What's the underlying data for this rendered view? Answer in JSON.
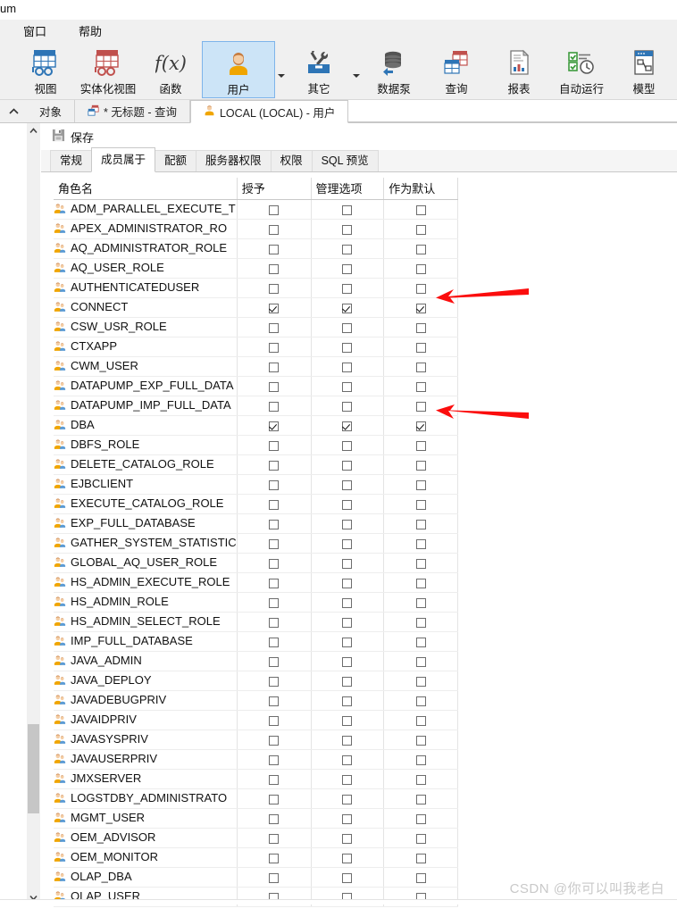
{
  "window": {
    "stray_title_fragment": "um"
  },
  "menubar": {
    "items": [
      {
        "label": "窗口",
        "name": "menu-window"
      },
      {
        "label": "帮助",
        "name": "menu-help"
      }
    ]
  },
  "ribbon": {
    "items": [
      {
        "label": "视图",
        "icon": "view-table-icon",
        "selected": false,
        "dropdown": false
      },
      {
        "label": "实体化视图",
        "icon": "materialized-view-icon",
        "selected": false,
        "dropdown": false
      },
      {
        "label": "函数",
        "icon": "function-fx-icon",
        "selected": false,
        "dropdown": false
      },
      {
        "label": "用户",
        "icon": "user-icon",
        "selected": true,
        "dropdown": true
      },
      {
        "label": "其它",
        "icon": "tools-icon",
        "selected": false,
        "dropdown": true
      },
      {
        "label": "数据泵",
        "icon": "datapump-icon",
        "selected": false,
        "dropdown": false
      },
      {
        "label": "查询",
        "icon": "query-icon",
        "selected": false,
        "dropdown": false
      },
      {
        "label": "报表",
        "icon": "report-icon",
        "selected": false,
        "dropdown": false
      },
      {
        "label": "自动运行",
        "icon": "automation-icon",
        "selected": false,
        "dropdown": false
      },
      {
        "label": "模型",
        "icon": "model-icon",
        "selected": false,
        "dropdown": false
      }
    ]
  },
  "tabstrip": {
    "collapse_icon": "chevron-up-icon",
    "tabs": [
      {
        "label": "对象",
        "icon": "",
        "active": false
      },
      {
        "label": "* 无标题 - 查询",
        "icon": "query-icon",
        "active": false
      },
      {
        "label": "LOCAL (LOCAL) - 用户",
        "icon": "user-icon",
        "active": true
      }
    ]
  },
  "toolbar": {
    "save_label": "保存",
    "save_icon": "save-icon"
  },
  "subtabs": [
    {
      "label": "常规",
      "active": false
    },
    {
      "label": "成员属于",
      "active": true
    },
    {
      "label": "配额",
      "active": false
    },
    {
      "label": "服务器权限",
      "active": false
    },
    {
      "label": "权限",
      "active": false
    },
    {
      "label": "SQL 预览",
      "active": false
    }
  ],
  "grid": {
    "columns": [
      "角色名",
      "授予",
      "管理选项",
      "作为默认"
    ],
    "rows": [
      {
        "name": "ADM_PARALLEL_EXECUTE_T",
        "granted": false,
        "admin": false,
        "default": false
      },
      {
        "name": "APEX_ADMINISTRATOR_RO",
        "granted": false,
        "admin": false,
        "default": false
      },
      {
        "name": "AQ_ADMINISTRATOR_ROLE",
        "granted": false,
        "admin": false,
        "default": false
      },
      {
        "name": "AQ_USER_ROLE",
        "granted": false,
        "admin": false,
        "default": false
      },
      {
        "name": "AUTHENTICATEDUSER",
        "granted": false,
        "admin": false,
        "default": false
      },
      {
        "name": "CONNECT",
        "granted": true,
        "admin": true,
        "default": true
      },
      {
        "name": "CSW_USR_ROLE",
        "granted": false,
        "admin": false,
        "default": false
      },
      {
        "name": "CTXAPP",
        "granted": false,
        "admin": false,
        "default": false
      },
      {
        "name": "CWM_USER",
        "granted": false,
        "admin": false,
        "default": false
      },
      {
        "name": "DATAPUMP_EXP_FULL_DATA",
        "granted": false,
        "admin": false,
        "default": false
      },
      {
        "name": "DATAPUMP_IMP_FULL_DATA",
        "granted": false,
        "admin": false,
        "default": false
      },
      {
        "name": "DBA",
        "granted": true,
        "admin": true,
        "default": true
      },
      {
        "name": "DBFS_ROLE",
        "granted": false,
        "admin": false,
        "default": false
      },
      {
        "name": "DELETE_CATALOG_ROLE",
        "granted": false,
        "admin": false,
        "default": false
      },
      {
        "name": "EJBCLIENT",
        "granted": false,
        "admin": false,
        "default": false
      },
      {
        "name": "EXECUTE_CATALOG_ROLE",
        "granted": false,
        "admin": false,
        "default": false
      },
      {
        "name": "EXP_FULL_DATABASE",
        "granted": false,
        "admin": false,
        "default": false
      },
      {
        "name": "GATHER_SYSTEM_STATISTIC",
        "granted": false,
        "admin": false,
        "default": false
      },
      {
        "name": "GLOBAL_AQ_USER_ROLE",
        "granted": false,
        "admin": false,
        "default": false
      },
      {
        "name": "HS_ADMIN_EXECUTE_ROLE",
        "granted": false,
        "admin": false,
        "default": false
      },
      {
        "name": "HS_ADMIN_ROLE",
        "granted": false,
        "admin": false,
        "default": false
      },
      {
        "name": "HS_ADMIN_SELECT_ROLE",
        "granted": false,
        "admin": false,
        "default": false
      },
      {
        "name": "IMP_FULL_DATABASE",
        "granted": false,
        "admin": false,
        "default": false
      },
      {
        "name": "JAVA_ADMIN",
        "granted": false,
        "admin": false,
        "default": false
      },
      {
        "name": "JAVA_DEPLOY",
        "granted": false,
        "admin": false,
        "default": false
      },
      {
        "name": "JAVADEBUGPRIV",
        "granted": false,
        "admin": false,
        "default": false
      },
      {
        "name": "JAVAIDPRIV",
        "granted": false,
        "admin": false,
        "default": false
      },
      {
        "name": "JAVASYSPRIV",
        "granted": false,
        "admin": false,
        "default": false
      },
      {
        "name": "JAVAUSERPRIV",
        "granted": false,
        "admin": false,
        "default": false
      },
      {
        "name": "JMXSERVER",
        "granted": false,
        "admin": false,
        "default": false
      },
      {
        "name": "LOGSTDBY_ADMINISTRATO",
        "granted": false,
        "admin": false,
        "default": false
      },
      {
        "name": "MGMT_USER",
        "granted": false,
        "admin": false,
        "default": false
      },
      {
        "name": "OEM_ADVISOR",
        "granted": false,
        "admin": false,
        "default": false
      },
      {
        "name": "OEM_MONITOR",
        "granted": false,
        "admin": false,
        "default": false
      },
      {
        "name": "OLAP_DBA",
        "granted": false,
        "admin": false,
        "default": false
      },
      {
        "name": "OLAP_USER",
        "granted": false,
        "admin": false,
        "default": false
      }
    ]
  },
  "annotations": {
    "color": "#fb0d0d",
    "arrows": [
      {
        "target_row": "CONNECT",
        "direction": "left"
      },
      {
        "target_row": "DBA",
        "direction": "left"
      }
    ]
  },
  "watermark": {
    "text": "CSDN @你可以叫我老白"
  }
}
